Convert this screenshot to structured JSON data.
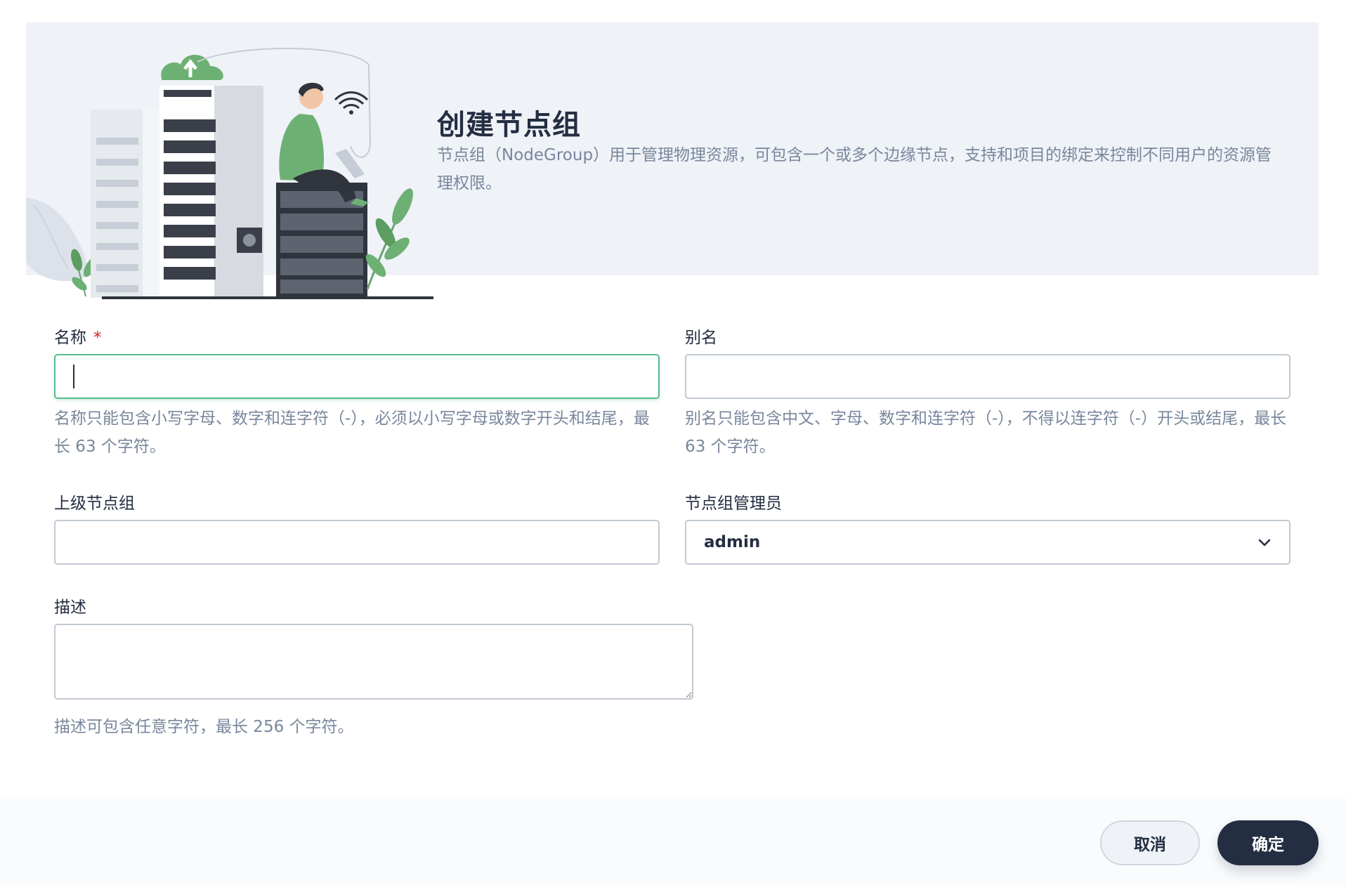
{
  "banner": {
    "title": "创建节点组",
    "description": "节点组（NodeGroup）用于管理物理资源，可包含一个或多个边缘节点，支持和项目的绑定来控制不同用户的资源管理权限。"
  },
  "form": {
    "name": {
      "label": "名称",
      "required_mark": "*",
      "value": "",
      "hint": "名称只能包含小写字母、数字和连字符（-），必须以小写字母或数字开头和结尾，最长 63 个字符。"
    },
    "alias": {
      "label": "别名",
      "value": "",
      "hint": "别名只能包含中文、字母、数字和连字符（-），不得以连字符（-）开头或结尾，最长 63 个字符。"
    },
    "parent": {
      "label": "上级节点组",
      "value": ""
    },
    "manager": {
      "label": "节点组管理员",
      "selected": "admin",
      "icon": "chevron-down-icon"
    },
    "description": {
      "label": "描述",
      "value": "",
      "hint": "描述可包含任意字符，最长 256 个字符。"
    }
  },
  "footer": {
    "cancel_label": "取消",
    "ok_label": "确定"
  },
  "colors": {
    "accent_green": "#55bc8a",
    "primary_dark": "#242e42",
    "hint_gray": "#79879c",
    "banner_bg": "#eff2f7",
    "required_red": "#ca2621"
  }
}
